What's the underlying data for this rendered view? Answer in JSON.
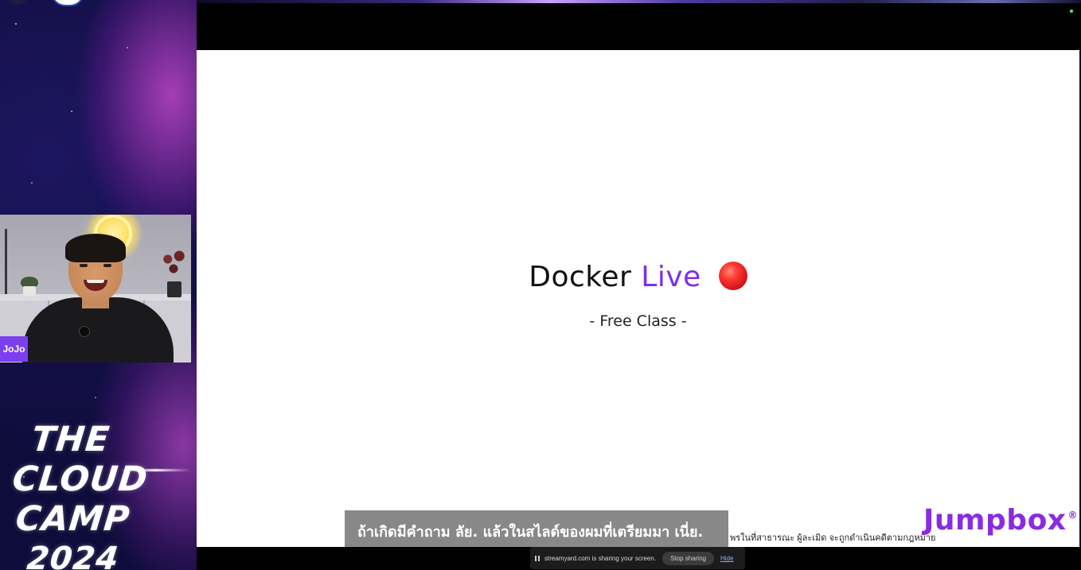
{
  "stream": {
    "presenter_name": "JoJo",
    "event_logo_lines": [
      "THE",
      "CLOUD",
      "CAMP",
      "2024"
    ]
  },
  "slide": {
    "title_prefix": "Docker",
    "title_highlight": "Live",
    "subtitle": "- Free Class -",
    "brand": "Jumpbox",
    "brand_mark": "®",
    "disclaimer": "พรในที่สาธารณะ ผู้ละเมิด จะถูกดำเนินคดีตามกฎหมาย",
    "accent_color": "#7b2ff0",
    "live_indicator_icon": "red-circle-icon"
  },
  "caption": {
    "text": "ถ้าเกิดมีคำถาม ลัย. แล้วในสไลด์ของผมที่เตรียมมา เนี่ย."
  },
  "share_bar": {
    "message": "streamyard.com is sharing your screen.",
    "stop_label": "Stop sharing",
    "hide_label": "Hide"
  }
}
